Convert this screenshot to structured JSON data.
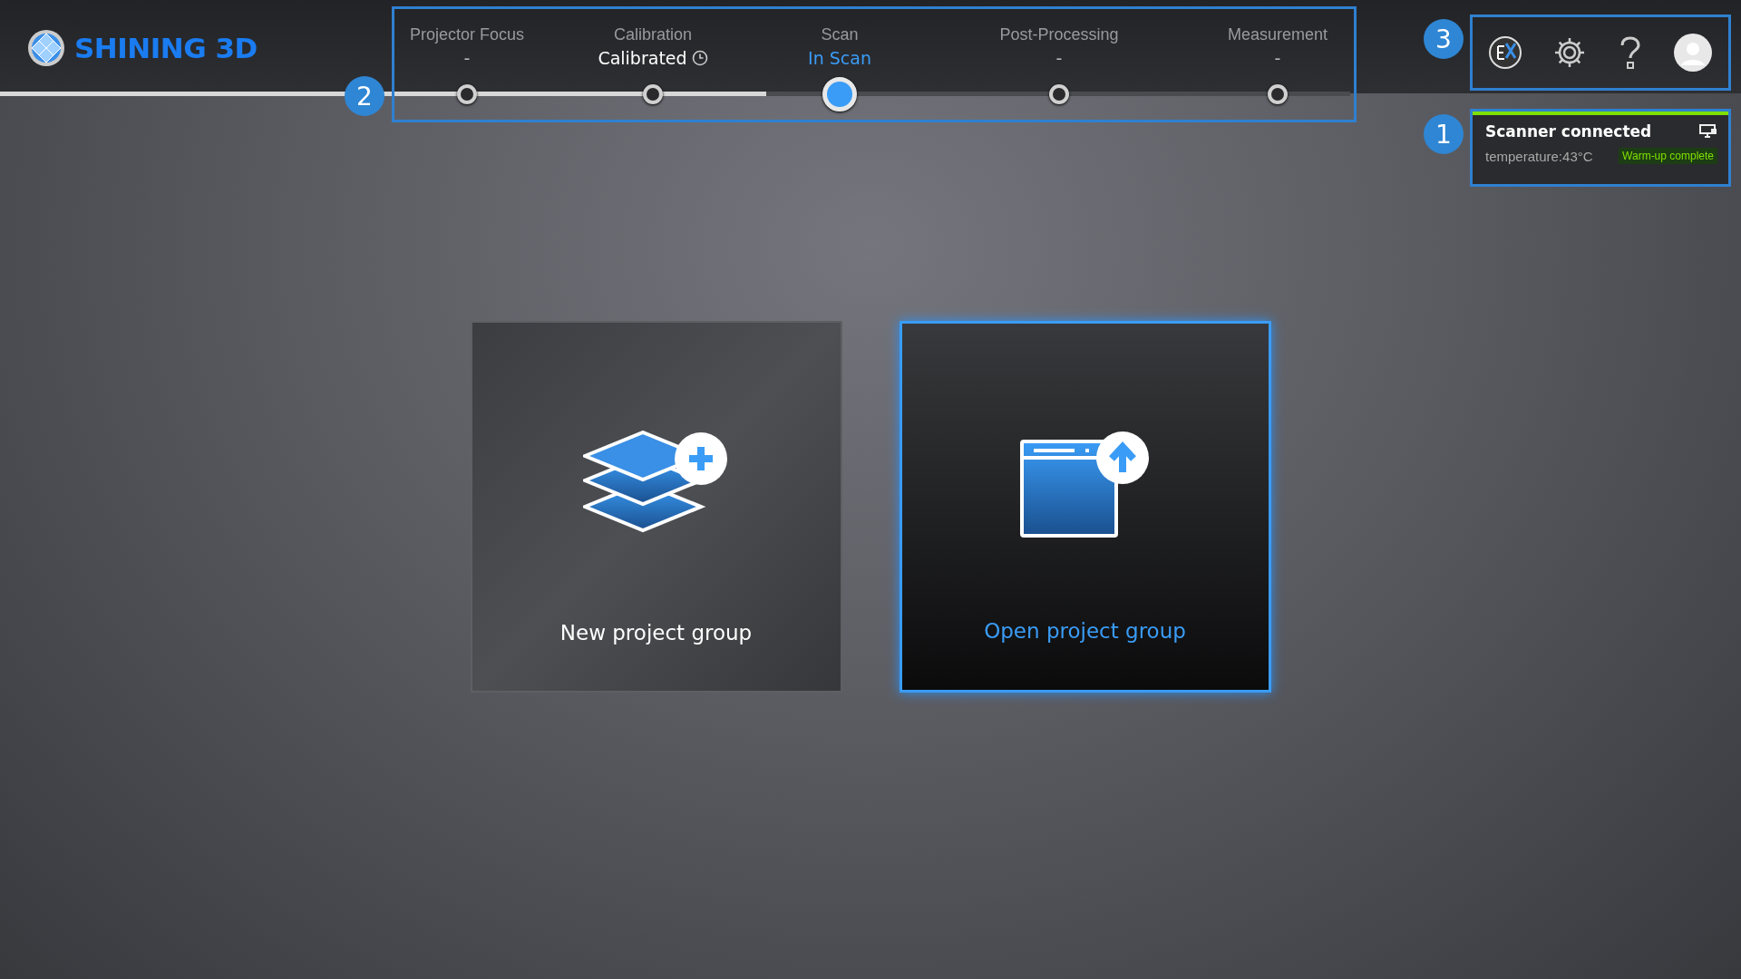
{
  "brand": {
    "name": "SHINING 3D"
  },
  "workflow": {
    "callout": "2",
    "steps": [
      {
        "label": "Projector Focus",
        "status": "-",
        "selected": false,
        "timed": false
      },
      {
        "label": "Calibration",
        "status": "Calibrated",
        "selected": false,
        "timed": true
      },
      {
        "label": "Scan",
        "status": "In Scan",
        "selected": true,
        "timed": false
      },
      {
        "label": "Post-Processing",
        "status": "-",
        "selected": false,
        "timed": false
      },
      {
        "label": "Measurement",
        "status": "-",
        "selected": false,
        "timed": false
      }
    ]
  },
  "toolbar": {
    "callout": "3"
  },
  "scanner_status": {
    "callout": "1",
    "title": "Scanner connected",
    "temperature": "temperature:43°C",
    "badge": "Warm-up complete",
    "connected": true
  },
  "cards": [
    {
      "kind": "new",
      "label": "New project group",
      "selected": false
    },
    {
      "kind": "open",
      "label": "Open project group",
      "selected": true
    }
  ]
}
